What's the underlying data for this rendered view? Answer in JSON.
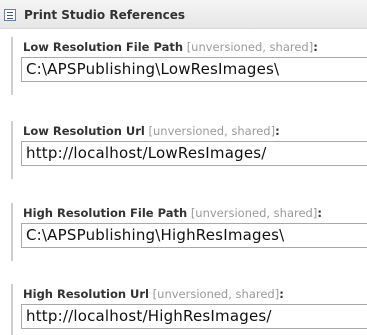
{
  "section": {
    "icon": "document-list-icon",
    "title": "Print Studio References"
  },
  "fields": [
    {
      "name": "Low Resolution File Path",
      "meta": "[unversioned, shared]",
      "colon": ":",
      "value": "C:\\APSPublishing\\LowResImages\\"
    },
    {
      "name": "Low Resolution Url",
      "meta": "[unversioned, shared]",
      "colon": ":",
      "value": "http://localhost/LowResImages/"
    },
    {
      "name": "High Resolution File Path",
      "meta": "[unversioned, shared]",
      "colon": ":",
      "value": "C:\\APSPublishing\\HighResImages\\"
    },
    {
      "name": "High Resolution Url",
      "meta": "[unversioned, shared]",
      "colon": ":",
      "value": "http://localhost/HighResImages/"
    }
  ]
}
